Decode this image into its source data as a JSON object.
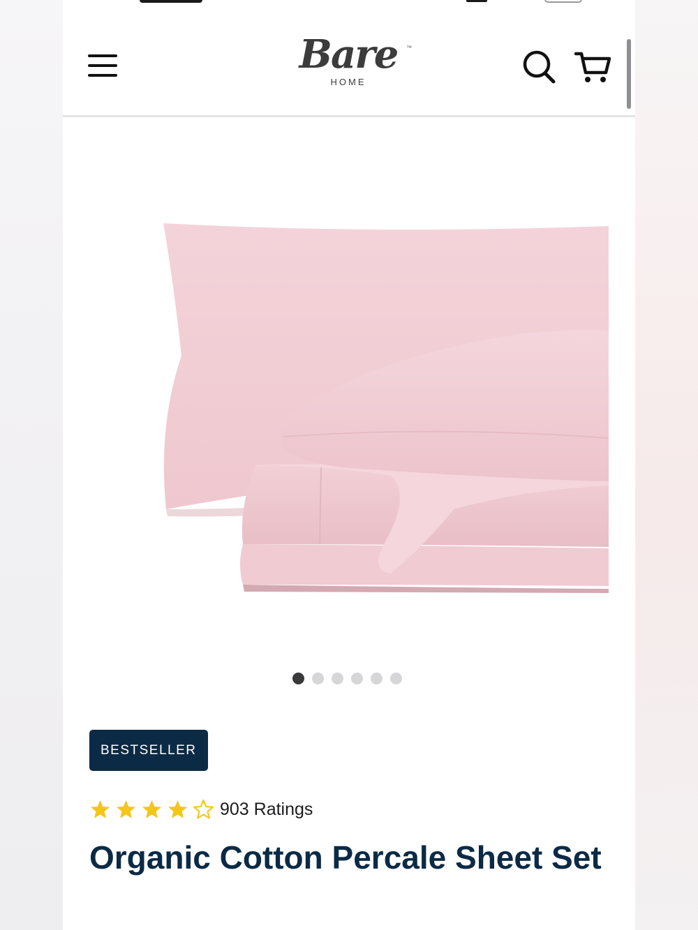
{
  "brand": {
    "name": "Bare",
    "tagline": "HOME",
    "trademark": "™"
  },
  "header": {
    "menu_icon": "hamburger-menu-icon",
    "search_icon": "search-icon",
    "cart_icon": "cart-icon"
  },
  "gallery": {
    "image_subject": "pink sheet set with pillowcases",
    "image_color": "#f2cfd6",
    "slide_count": 6,
    "active_slide": 1
  },
  "product": {
    "badge": "BESTSELLER",
    "rating_value": 4,
    "rating_max": 5,
    "ratings_count_label": "903 Ratings",
    "title": "Organic Cotton Percale Sheet Set"
  },
  "colors": {
    "navy": "#0b2a45",
    "star": "#f5c518",
    "dot_active": "#3a3a3c",
    "dot_inactive": "#d6d6d8"
  }
}
